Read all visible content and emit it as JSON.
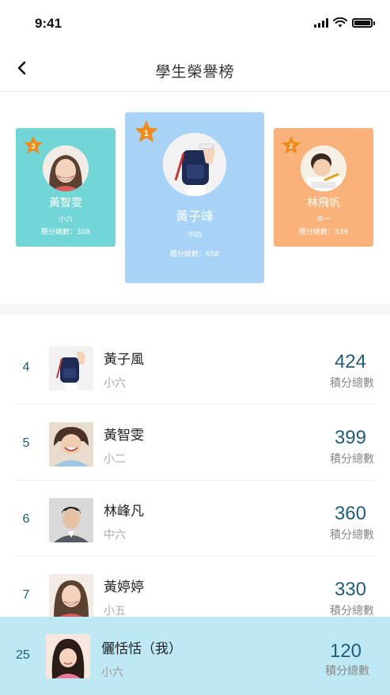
{
  "status_bar": {
    "time": "9:41"
  },
  "nav": {
    "title": "學生榮譽榜",
    "back_icon": "chevron-left-icon"
  },
  "podium": [
    {
      "place": "3",
      "name": "黃智雯",
      "grade": "小六",
      "score_text": "積分總數：308",
      "color": "#72d6d6"
    },
    {
      "place": "1",
      "name": "黃子峰",
      "grade": "中四",
      "score_text": "積分總數：658",
      "color": "#a9d2f7"
    },
    {
      "place": "2",
      "name": "林飛帆",
      "grade": "中一",
      "score_text": "積分總數：339",
      "color": "#fbb27a"
    }
  ],
  "star_color": "#f28a17",
  "rankings": [
    {
      "rank": "4",
      "name": "黃子風",
      "grade": "小六",
      "score": "424",
      "score_label": "積分總數"
    },
    {
      "rank": "5",
      "name": "黃智雯",
      "grade": "小二",
      "score": "399",
      "score_label": "積分總數"
    },
    {
      "rank": "6",
      "name": "林峰凡",
      "grade": "中六",
      "score": "360",
      "score_label": "積分總數"
    },
    {
      "rank": "7",
      "name": "黃婷婷",
      "grade": "小五",
      "score": "330",
      "score_label": "積分總數"
    }
  ],
  "me": {
    "rank": "25",
    "name": "儷恬恬（我）",
    "grade": "小六",
    "score": "120",
    "score_label": "積分總數"
  },
  "accent_color": "#1f5d78"
}
